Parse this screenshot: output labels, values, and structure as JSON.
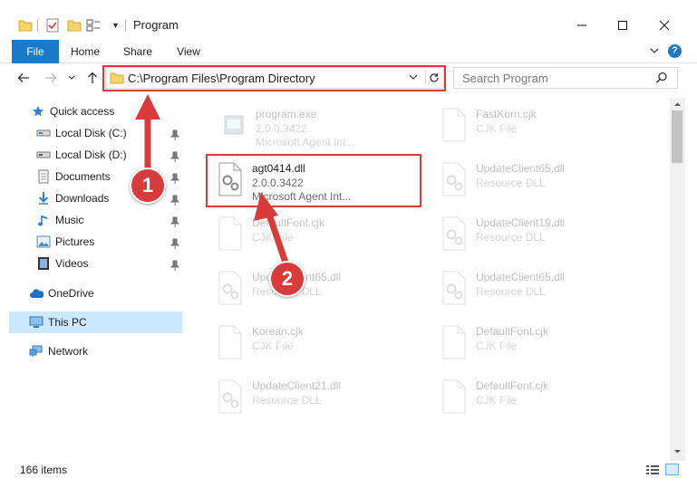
{
  "window": {
    "title": "Program"
  },
  "ribbon": {
    "tabs": [
      "File",
      "Home",
      "Share",
      "View"
    ],
    "help": "?"
  },
  "address": {
    "path": "C:\\Program Files\\Program Directory"
  },
  "search": {
    "placeholder": "Search Program"
  },
  "nav": {
    "items": [
      {
        "label": "Quick access",
        "icon": "star-icon"
      },
      {
        "label": "Local Disk (C:)",
        "icon": "drive-icon",
        "pinned": true
      },
      {
        "label": "Local Disk (D:)",
        "icon": "drive-icon",
        "pinned": true
      },
      {
        "label": "Documents",
        "icon": "documents-icon",
        "pinned": true
      },
      {
        "label": "Downloads",
        "icon": "download-icon",
        "pinned": true
      },
      {
        "label": "Music",
        "icon": "music-icon",
        "pinned": true
      },
      {
        "label": "Pictures",
        "icon": "pictures-icon",
        "pinned": true
      },
      {
        "label": "Videos",
        "icon": "videos-icon",
        "pinned": true
      },
      {
        "label": "OneDrive",
        "icon": "cloud-icon"
      },
      {
        "label": "This PC",
        "icon": "computer-icon",
        "selected": true
      },
      {
        "label": "Network",
        "icon": "network-icon"
      }
    ]
  },
  "files": [
    {
      "name": "program.exe",
      "line1": "2.0.0.3422",
      "line2": "Microsoft Agent Int...",
      "icon": "exe-icon"
    },
    {
      "name": "FastKorn.cjk",
      "line1": "CJK File",
      "line2": "",
      "icon": "blank-file-icon"
    },
    {
      "name": "agt0414.dll",
      "line1": "2.0.0.3422",
      "line2": "Microsoft Agent Int...",
      "icon": "dll-icon"
    },
    {
      "name": "UpdateClient65.dll",
      "line1": "Resource DLL",
      "line2": "",
      "icon": "dll-icon"
    },
    {
      "name": "DefaultFont.cjk",
      "line1": "CJK File",
      "line2": "",
      "icon": "blank-file-icon"
    },
    {
      "name": "UpdateClient19.dll",
      "line1": "Resource DLL",
      "line2": "",
      "icon": "dll-icon"
    },
    {
      "name": "UpdateClient65.dll",
      "line1": "Resource DLL",
      "line2": "",
      "icon": "dll-icon"
    },
    {
      "name": "UpdateClient65.dll",
      "line1": "Resource DLL",
      "line2": "",
      "icon": "dll-icon"
    },
    {
      "name": "Korean.cjk",
      "line1": "CJK File",
      "line2": "",
      "icon": "blank-file-icon"
    },
    {
      "name": "DefaultFont.cjk",
      "line1": "CJK File",
      "line2": "",
      "icon": "blank-file-icon"
    },
    {
      "name": "UpdateClient21.dll",
      "line1": "Resource DLL",
      "line2": "",
      "icon": "dll-icon"
    },
    {
      "name": "DefaultFont.cjk",
      "line1": "CJK File",
      "line2": "",
      "icon": "blank-file-icon"
    }
  ],
  "status": {
    "items": "166 items"
  },
  "callouts": {
    "one": "1",
    "two": "2"
  },
  "colors": {
    "accent": "#1979ca",
    "highlight": "#d93b3b",
    "selected": "#cce8ff"
  }
}
